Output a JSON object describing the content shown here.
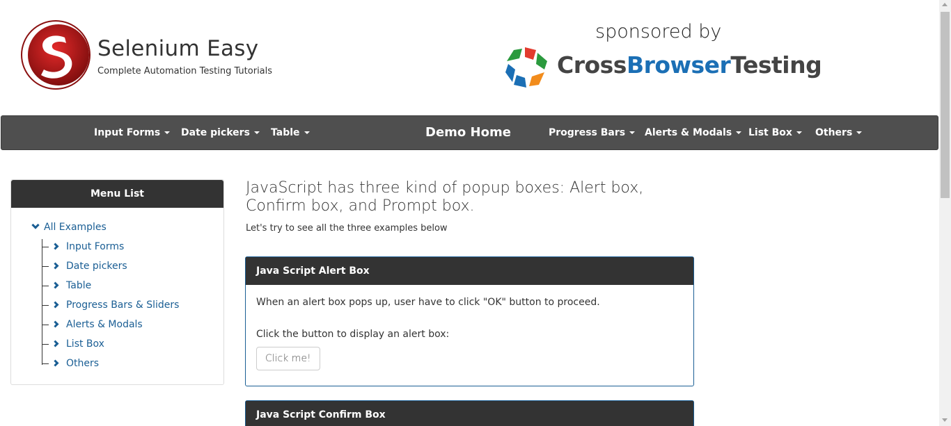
{
  "brand": {
    "title": "Selenium Easy",
    "subtitle": "Complete Automation Testing Tutorials"
  },
  "sponsor": {
    "label": "sponsored by",
    "name_part1": "Cross",
    "name_part2": "Browser",
    "name_part3": "Testing"
  },
  "nav": {
    "left": [
      "Input Forms",
      "Date pickers",
      "Table"
    ],
    "home": "Demo Home",
    "right": [
      "Progress Bars",
      "Alerts & Modals",
      "List Box",
      "Others"
    ]
  },
  "sidebar": {
    "title": "Menu List",
    "root": "All Examples",
    "items": [
      "Input Forms",
      "Date pickers",
      "Table",
      "Progress Bars & Sliders",
      "Alerts & Modals",
      "List Box",
      "Others"
    ]
  },
  "main": {
    "title": "JavaScript has three kind of popup boxes: Alert box, Confirm box, and Prompt box.",
    "subtitle": "Let's try to see all the three examples below"
  },
  "alert_panel": {
    "title": "Java Script Alert Box",
    "desc": "When an alert box pops up, user have to click \"OK\" button to proceed.",
    "instruction": "Click the button to display an alert box:",
    "button": "Click me!"
  },
  "confirm_panel": {
    "title": "Java Script Confirm Box"
  },
  "colors": {
    "navbar": "#4f4f4f",
    "panel_header": "#333333",
    "link": "#1a5e94",
    "panel_border": "#1a5e94"
  }
}
